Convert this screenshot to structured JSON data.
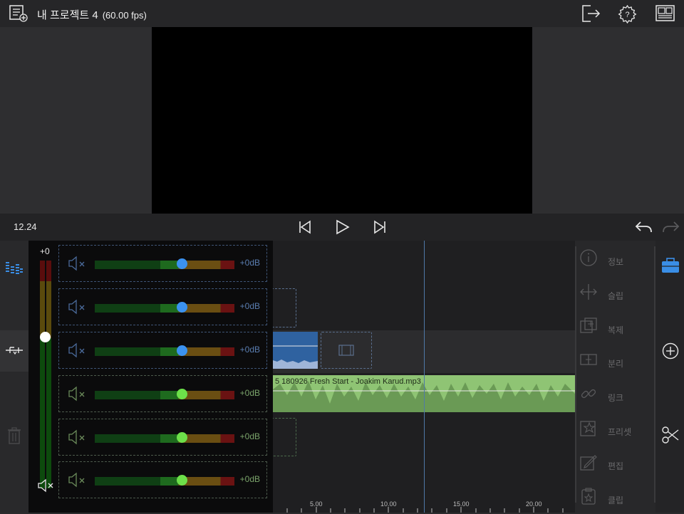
{
  "project": {
    "title": "내 프로젝트 4",
    "fps": "(60.00 fps)"
  },
  "header_icons": [
    "project-list-icon",
    "export-icon",
    "settings-icon",
    "layout-icon"
  ],
  "transport": {
    "time": "12.24"
  },
  "mixer": {
    "master_label": "+0",
    "channels": [
      {
        "db": "+0dB",
        "color": "blue",
        "level": 0.62
      },
      {
        "db": "+0dB",
        "color": "blue",
        "level": 0.62
      },
      {
        "db": "+0dB",
        "color": "blue",
        "level": 0.62
      },
      {
        "db": "+0dB",
        "color": "green",
        "level": 0.62
      },
      {
        "db": "+0dB",
        "color": "green",
        "level": 0.62
      },
      {
        "db": "+0dB",
        "color": "green",
        "level": 0.62
      }
    ]
  },
  "timeline": {
    "audio_clip_label": "5   180926 Fresh Start - Joakim Karud.mp3",
    "ruler": [
      "5.00",
      "10.00",
      "15.00",
      "20.00"
    ]
  },
  "tools": [
    {
      "label": "정보",
      "icon": "info-icon"
    },
    {
      "label": "슬립",
      "icon": "slip-icon"
    },
    {
      "label": "복제",
      "icon": "duplicate-icon"
    },
    {
      "label": "분리",
      "icon": "split-icon"
    },
    {
      "label": "링크",
      "icon": "link-icon"
    },
    {
      "label": "프리셋",
      "icon": "preset-icon"
    },
    {
      "label": "편집",
      "icon": "edit-icon"
    },
    {
      "label": "클립",
      "icon": "clip-icon"
    }
  ],
  "colors": {
    "accent": "#3a8ee6",
    "green_knob": "#6de04a",
    "blue_knob": "#3b92f0",
    "audio_clip": "#8fc474"
  }
}
